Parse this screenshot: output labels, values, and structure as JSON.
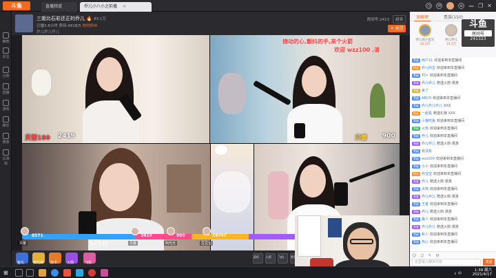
{
  "browser": {
    "tabs": [
      {
        "label": "直播频道",
        "active": false
      },
      {
        "label": "乔儿小八小之前播",
        "active": true
      }
    ],
    "window_controls": [
      "—",
      "❐",
      "✕"
    ]
  },
  "sidebar": {
    "items": [
      "推荐",
      "关注",
      "分类",
      "直播",
      "游戏",
      "娱乐",
      "赛事",
      "云游戏"
    ]
  },
  "room": {
    "title": "三姐比石彩还正的乔儿",
    "fire_icon": "🔥",
    "heat": "83.1万",
    "room_meta": "已播3.8小时 房间:4818/5",
    "extra_meta": "他的粉丝",
    "host_name": "乔儿乔儿乔儿",
    "room_id": "房间号:2413",
    "quality": "超清",
    "follow_label": "+ 关注"
  },
  "video": {
    "overlay_line1": "撩动的心,颤抖的手,来个火箭",
    "overlay_line2": "欢迎 wzz100 ,请",
    "scores": {
      "c1_label": "贝蕾180",
      "c1_value": "2419",
      "c2_value": "900",
      "c2_label": "贝蕾"
    }
  },
  "pk": {
    "left_value": "8571",
    "big_value": "14747",
    "players": [
      {
        "name": "贝蕾",
        "value": "8571"
      },
      {
        "name": "贝蕾",
        "value": "2419"
      },
      {
        "name": "阿光光",
        "value": "900"
      },
      {
        "name": "豆豆宝",
        "value": "14747"
      }
    ]
  },
  "gifts": {
    "items": [
      "鱼丸",
      "荧光棒",
      "办卡",
      "火箭",
      "飞机"
    ],
    "right_items": [
      "奖杯",
      "火箭",
      "飞机",
      "更多"
    ]
  },
  "chat": {
    "tabs": [
      "贡献榜",
      "贵族(150)",
      "粉丝团"
    ],
    "rank_title": "房间号",
    "rank_number": "241323",
    "rank": [
      {
        "name": "乔儿的小宝贝",
        "value": "26.5万"
      },
      {
        "name": "乔儿乔儿",
        "value": "10.3万"
      },
      {
        "name": "阿光",
        "value": "9.3万"
      }
    ],
    "watermark_top": "斗鱼",
    "watermark_mid": "房间号",
    "watermark_num": "241323",
    "messages": [
      {
        "badge": "等级",
        "badge_color": "b-blue",
        "user": "用户11",
        "text": "欢迎来到本直播间"
      },
      {
        "badge": "粉丝",
        "badge_color": "b-or",
        "user": "乔儿的宝",
        "text": "欢迎来到本直播间"
      },
      {
        "badge": "等级",
        "badge_color": "b-blue",
        "user": "TD•",
        "text": "欢迎来到本直播间"
      },
      {
        "badge": "贵族",
        "badge_color": "b-pur",
        "user": "乔儿乔儿",
        "text": "赠送火箭·漫游"
      },
      {
        "badge": "等级",
        "badge_color": "b-gold",
        "user": "来了",
        "text": ""
      },
      {
        "badge": "等级",
        "badge_color": "b-blue",
        "user": "ABCD",
        "text": "欢迎来到本直播间"
      },
      {
        "badge": "等级",
        "badge_color": "b-blue",
        "user": "乔儿乔儿乔儿",
        "text": "XXX"
      },
      {
        "badge": "粉丝",
        "badge_color": "b-or",
        "user": "一起看",
        "text": "赠送礼物 XXX"
      },
      {
        "badge": "等级",
        "badge_color": "b-blue",
        "user": "小猫吃鱼",
        "text": "欢迎来到本直播间"
      },
      {
        "badge": "等级",
        "badge_color": "b-grn",
        "user": "火箭",
        "text": "欢迎来到本直播间"
      },
      {
        "badge": "等级",
        "badge_color": "b-blue",
        "user": "乔儿",
        "text": "欢迎来到本直播间"
      },
      {
        "badge": "贵族",
        "badge_color": "b-pur",
        "user": "乔儿乔儿",
        "text": "赠送火箭·漫游"
      },
      {
        "badge": "等级",
        "badge_color": "b-blue",
        "user": "有没有",
        "text": ""
      },
      {
        "badge": "等级",
        "badge_color": "b-blue",
        "user": "wzz100",
        "text": "欢迎来到本直播间"
      },
      {
        "badge": "等级",
        "badge_color": "b-blue",
        "user": "小小",
        "text": "欢迎来到本直播间"
      },
      {
        "badge": "粉丝",
        "badge_color": "b-or",
        "user": "乔宝宝",
        "text": "欢迎来到本直播间"
      },
      {
        "badge": "贵族",
        "badge_color": "b-pur",
        "user": "乔儿",
        "text": "赠送火箭·漫游"
      },
      {
        "badge": "等级",
        "badge_color": "b-blue",
        "user": "大熊",
        "text": "欢迎来到本直播间"
      },
      {
        "badge": "贵族",
        "badge_color": "b-pur",
        "user": "乔儿乔儿",
        "text": "赠送火箭·漫游"
      },
      {
        "badge": "等级",
        "badge_color": "b-blue",
        "user": "王者",
        "text": "欢迎来到本直播间"
      },
      {
        "badge": "贵族",
        "badge_color": "b-pur",
        "user": "乔儿",
        "text": "赠送火箭·漫游"
      },
      {
        "badge": "等级",
        "badge_color": "b-blue",
        "user": "路人",
        "text": "欢迎来到本直播间"
      },
      {
        "badge": "贵族",
        "badge_color": "b-pur",
        "user": "乔儿乔儿",
        "text": "赠送火箭·漫游"
      },
      {
        "badge": "等级",
        "badge_color": "b-blue",
        "user": "新人",
        "text": "欢迎来到本直播间"
      },
      {
        "badge": "等级",
        "badge_color": "b-blue",
        "user": "热心",
        "text": "欢迎来到本直播间"
      }
    ],
    "input_placeholder": "这里输入聊天内容",
    "send_label": "发送",
    "tools": "☺ ♫ ✎ ⚙"
  },
  "taskbar": {
    "start": "⊞",
    "tray": "∧ 中",
    "time": "1:39 周六",
    "date": "2021/4/17"
  },
  "colors": {
    "brand": "#f26a21",
    "pk_blue": "#2fa4ff",
    "pk_pink": "#ff4a8d"
  }
}
